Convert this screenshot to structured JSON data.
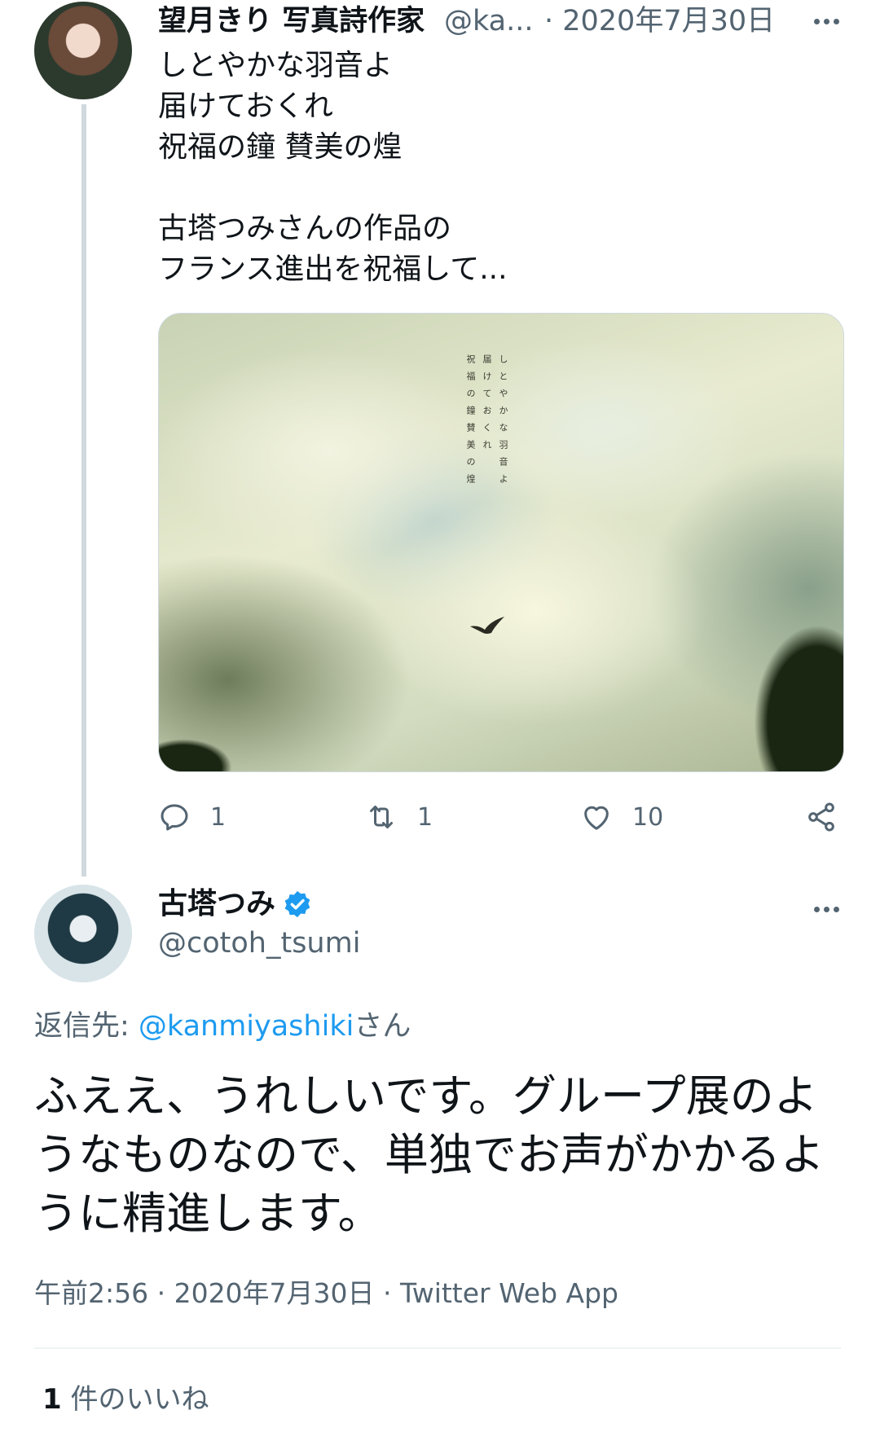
{
  "tweet1": {
    "author_name": "望月きり 写真詩作家",
    "author_handle": "@ka...",
    "date": "· 2020年7月30日",
    "body": "しとやかな羽音よ\n届けておくれ\n祝福の鐘 賛美の煌\n\n古塔つみさんの作品の\nフランス進出を祝福して...",
    "image_poem": [
      "しとやかな羽音よ",
      "届けておくれ",
      "祝福の鐘賛美の煌"
    ],
    "actions": {
      "replies": "1",
      "retweets": "1",
      "likes": "10"
    },
    "icons": [
      "reply-icon",
      "retweet-icon",
      "like-icon",
      "share-icon",
      "more-icon"
    ]
  },
  "tweet2": {
    "author_name": "古塔つみ",
    "author_handle": "@cotoh_tsumi",
    "reply_prefix": "返信先: ",
    "reply_mention": "@kanmiyashiki",
    "reply_suffix": "さん",
    "body": "ふええ、うれしいです。グループ展のようなものなので、単独でお声がかかるように精進します。",
    "meta": "午前2:56 · 2020年7月30日 · Twitter Web App",
    "likes_count": "1",
    "likes_label": " 件のいいね",
    "icons": [
      "verified-badge-icon",
      "more-icon"
    ]
  },
  "colors": {
    "accent": "#1d9bf0",
    "secondary_text": "#536471",
    "primary_text": "#0f1419",
    "thread_line": "#cfd9de"
  }
}
